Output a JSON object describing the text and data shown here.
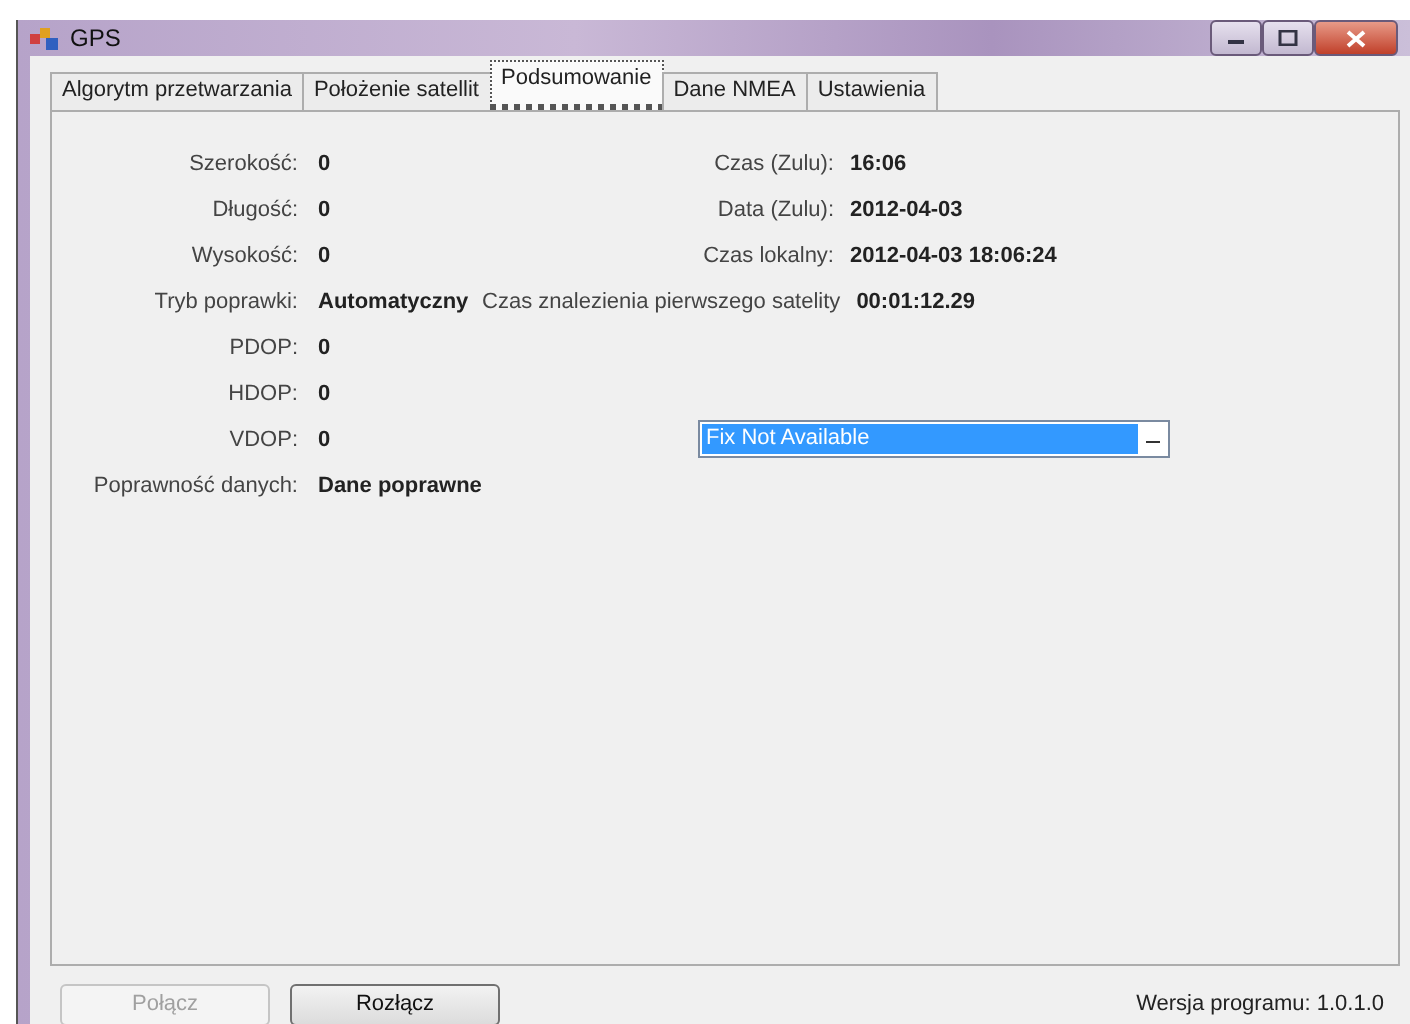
{
  "window": {
    "title": "GPS"
  },
  "tabs": [
    {
      "label": "Algorytm przetwarzania",
      "selected": false
    },
    {
      "label": "Położenie satellit",
      "selected": false
    },
    {
      "label": "Podsumowanie",
      "selected": true
    },
    {
      "label": "Dane NMEA",
      "selected": false
    },
    {
      "label": "Ustawienia",
      "selected": false
    }
  ],
  "rows": [
    {
      "label": "Szerokość:",
      "value": "0",
      "right": {
        "kind": "field",
        "label": "Czas (Zulu):",
        "value": "16:06"
      }
    },
    {
      "label": "Długość:",
      "value": "0",
      "right": {
        "kind": "field",
        "label": "Data (Zulu):",
        "value": "2012-04-03"
      }
    },
    {
      "label": "Wysokość:",
      "value": "0",
      "right": {
        "kind": "field",
        "label": "Czas lokalny:",
        "value": "2012-04-03 18:06:24"
      }
    },
    {
      "label": "Tryb poprawki:",
      "value": "Automatyczny",
      "right": {
        "kind": "field",
        "label": "Czas znalezienia pierwszego satelity",
        "value": "00:01:12.29"
      }
    },
    {
      "label": "PDOP:",
      "value": "0"
    },
    {
      "label": "HDOP:",
      "value": "0"
    },
    {
      "label": "VDOP:",
      "value": "0",
      "right": {
        "kind": "dropdown",
        "value": "Fix Not Available"
      }
    },
    {
      "label": "Poprawność danych:",
      "value": "Dane poprawne"
    }
  ],
  "buttons": [
    {
      "label": "Połącz",
      "disabled": true
    },
    {
      "label": "Rozłącz",
      "disabled": false
    }
  ],
  "version": "Wersja programu: 1.0.1.0"
}
